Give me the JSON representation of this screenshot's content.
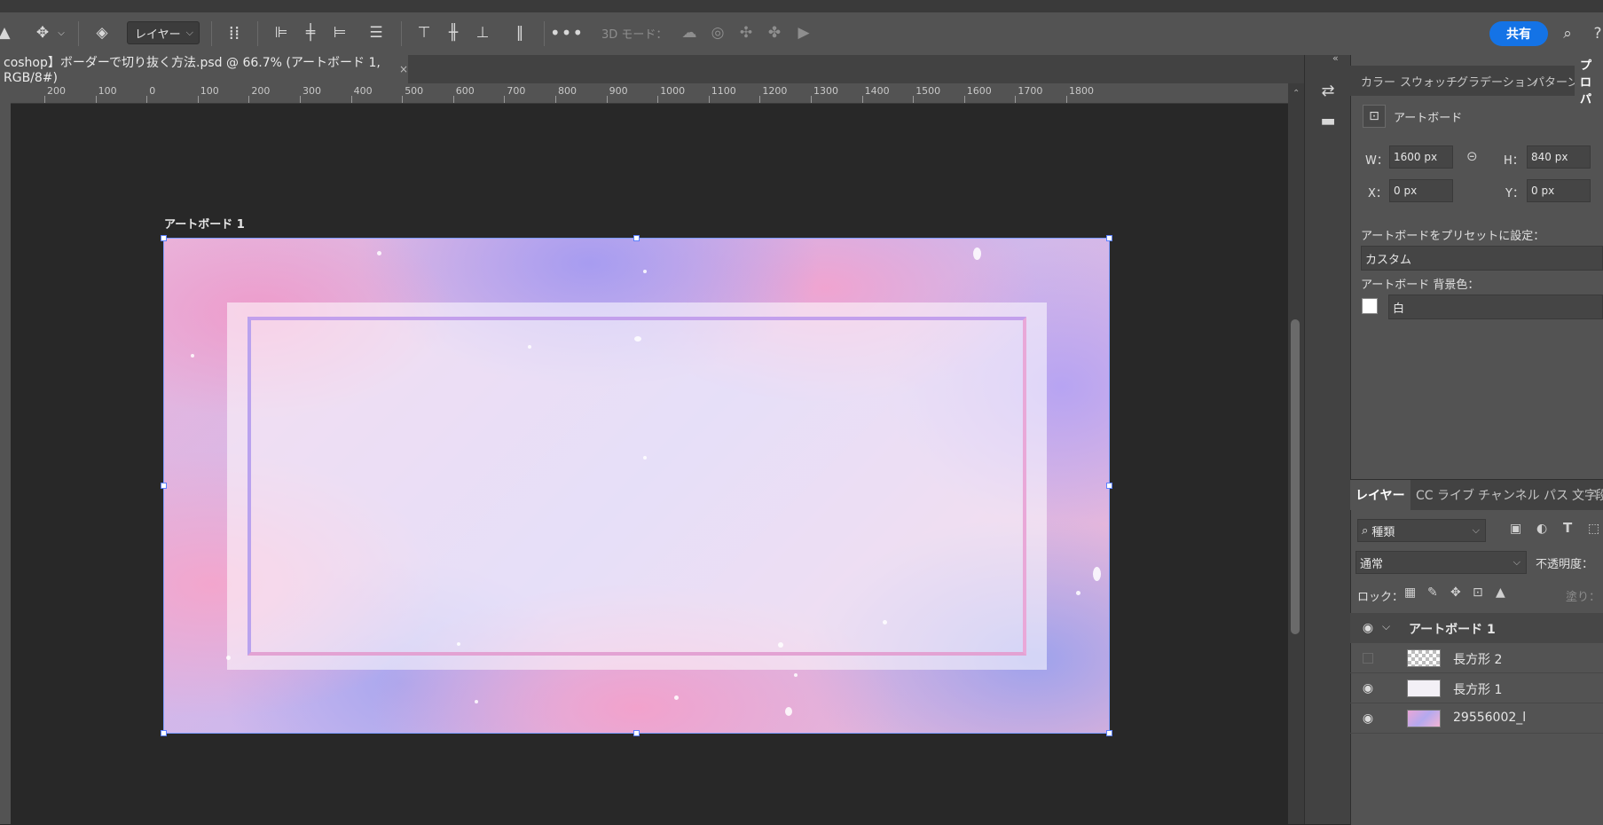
{
  "toolbar": {
    "layer_dropdown": "レイヤー",
    "mode_3d_label": "3D モード："
  },
  "share_button": "共有",
  "document": {
    "tab_title": "coshop】ボーダーで切り抜く方法.psd @ 66.7% (アートボード 1, RGB/8#)",
    "close_glyph": "×"
  },
  "ruler": [
    "200",
    "100",
    "0",
    "100",
    "200",
    "300",
    "400",
    "500",
    "600",
    "700",
    "800",
    "900",
    "1000",
    "1100",
    "1200",
    "1300",
    "1400",
    "1500",
    "1600",
    "1700",
    "1800"
  ],
  "canvas": {
    "artboard_label": "アートボード 1"
  },
  "properties": {
    "tabs": [
      "カラー",
      "スウォッチ",
      "グラデーション",
      "パターン",
      "プロパ"
    ],
    "section_title": "アートボード",
    "w_label": "W：",
    "w_value": "1600 px",
    "h_label": "H：",
    "h_value": "840 px",
    "x_label": "X：",
    "x_value": "0 px",
    "y_label": "Y：",
    "y_value": "0 px",
    "preset_label": "アートボードをプリセットに設定：",
    "preset_value": "カスタム",
    "bg_label": "アートボード 背景色：",
    "bg_value": "白",
    "bg_color": "#ffffff"
  },
  "layers": {
    "tabs": [
      "レイヤー",
      "CC ライブ",
      "チャンネル",
      "パス",
      "文字",
      "段"
    ],
    "filter_value": "種類",
    "blend_mode": "通常",
    "opacity_label": "不透明度：",
    "lock_label": "ロック：",
    "fill_label": "塗り：",
    "items": [
      {
        "name": "アートボード 1",
        "visible": true
      },
      {
        "name": "長方形 2",
        "visible": false
      },
      {
        "name": "長方形 1",
        "visible": true
      },
      {
        "name": "29556002_l",
        "visible": true
      }
    ]
  },
  "colors": {
    "accent": "#1473e6",
    "selection": "#7d9cff",
    "panel": "#535353",
    "canvas": "#282828"
  }
}
